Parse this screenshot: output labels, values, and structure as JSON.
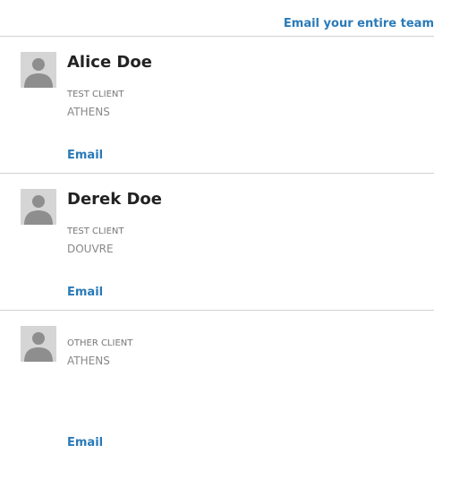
{
  "header": {
    "team_email_label": "Email your entire team"
  },
  "members": [
    {
      "name": "Alice Doe",
      "role": "TEST CLIENT",
      "city": "ATHENS",
      "email_label": "Email"
    },
    {
      "name": "Derek Doe",
      "role": "TEST CLIENT",
      "city": "DOUVRE",
      "email_label": "Email"
    },
    {
      "name": "",
      "role": "OTHER CLIENT",
      "city": "ATHENS",
      "email_label": "Email"
    }
  ],
  "icons": {
    "avatar": "person-silhouette-icon"
  },
  "colors": {
    "link": "#2a7ab8",
    "divider": "#d2d2d2",
    "name_text": "#222222",
    "meta_text": "#777777",
    "avatar_bg": "#d5d5d5",
    "avatar_figure": "#8e8e8e"
  }
}
